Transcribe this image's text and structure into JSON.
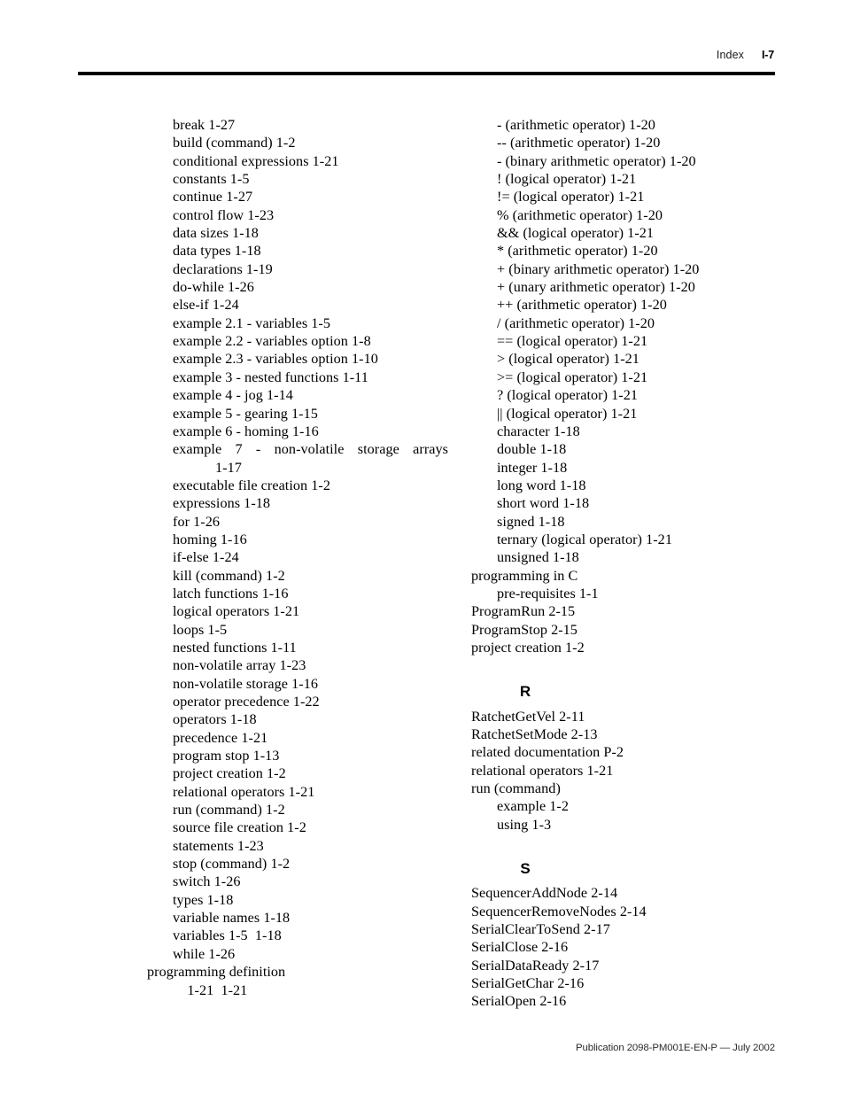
{
  "header": {
    "section_label": "Index",
    "folio": "I-7"
  },
  "footer": {
    "text": "Publication 2098-PM001E-EN-P — July 2002"
  },
  "columns": {
    "left": {
      "entries": [
        {
          "level": 2,
          "text": "break 1-27"
        },
        {
          "level": 2,
          "text": "build (command) 1-2"
        },
        {
          "level": 2,
          "text": "conditional expressions 1-21"
        },
        {
          "level": 2,
          "text": "constants 1-5"
        },
        {
          "level": 2,
          "text": "continue 1-27"
        },
        {
          "level": 2,
          "text": "control flow 1-23"
        },
        {
          "level": 2,
          "text": "data sizes 1-18"
        },
        {
          "level": 2,
          "text": "data types 1-18"
        },
        {
          "level": 2,
          "text": "declarations 1-19"
        },
        {
          "level": 2,
          "text": "do-while 1-26"
        },
        {
          "level": 2,
          "text": "else-if 1-24"
        },
        {
          "level": 2,
          "text": "example 2.1 - variables 1-5"
        },
        {
          "level": 2,
          "text": "example 2.2 - variables option 1-8"
        },
        {
          "level": 2,
          "text": "example 2.3 - variables option 1-10"
        },
        {
          "level": 2,
          "text": "example 3 - nested functions 1-11"
        },
        {
          "level": 2,
          "text": "example 4 - jog 1-14"
        },
        {
          "level": 2,
          "text": "example 5 - gearing 1-15"
        },
        {
          "level": 2,
          "text": "example 6 - homing 1-16"
        },
        {
          "level": 2,
          "wrap": true,
          "first": "example 7 - non-volatile storage arrays",
          "rest": "1-17"
        },
        {
          "level": 2,
          "text": "executable file creation 1-2"
        },
        {
          "level": 2,
          "text": "expressions 1-18"
        },
        {
          "level": 2,
          "text": "for 1-26"
        },
        {
          "level": 2,
          "text": "homing 1-16"
        },
        {
          "level": 2,
          "text": "if-else 1-24"
        },
        {
          "level": 2,
          "text": "kill (command) 1-2"
        },
        {
          "level": 2,
          "text": "latch functions 1-16"
        },
        {
          "level": 2,
          "text": "logical operators 1-21"
        },
        {
          "level": 2,
          "text": "loops 1-5"
        },
        {
          "level": 2,
          "text": "nested functions 1-11"
        },
        {
          "level": 2,
          "text": "non-volatile array 1-23"
        },
        {
          "level": 2,
          "text": "non-volatile storage 1-16"
        },
        {
          "level": 2,
          "text": "operator precedence 1-22"
        },
        {
          "level": 2,
          "text": "operators 1-18"
        },
        {
          "level": 2,
          "text": "precedence 1-21"
        },
        {
          "level": 2,
          "text": "program stop 1-13"
        },
        {
          "level": 2,
          "text": "project creation 1-2"
        },
        {
          "level": 2,
          "text": "relational operators 1-21"
        },
        {
          "level": 2,
          "text": "run (command) 1-2"
        },
        {
          "level": 2,
          "text": "source file creation 1-2"
        },
        {
          "level": 2,
          "text": "statements 1-23"
        },
        {
          "level": 2,
          "text": "stop (command) 1-2"
        },
        {
          "level": 2,
          "text": "switch 1-26"
        },
        {
          "level": 2,
          "text": "types 1-18"
        },
        {
          "level": 2,
          "text": "variable names 1-18"
        },
        {
          "level": 2,
          "text": "variables 1-5  1-18"
        },
        {
          "level": 2,
          "text": "while 1-26"
        },
        {
          "level": 1,
          "text": "programming definition"
        },
        {
          "level": 2,
          "text": "    1-21  1-21"
        }
      ]
    },
    "right": {
      "blocks": [
        {
          "type": "entries",
          "entries": [
            {
              "level": 2,
              "text": "- (arithmetic operator) 1-20"
            },
            {
              "level": 2,
              "text": "-- (arithmetic operator) 1-20"
            },
            {
              "level": 2,
              "text": "- (binary arithmetic operator) 1-20"
            },
            {
              "level": 2,
              "text": "! (logical operator) 1-21"
            },
            {
              "level": 2,
              "text": "!= (logical operator) 1-21"
            },
            {
              "level": 2,
              "text": "% (arithmetic operator) 1-20"
            },
            {
              "level": 2,
              "text": "&& (logical operator) 1-21"
            },
            {
              "level": 2,
              "text": "* (arithmetic operator) 1-20"
            },
            {
              "level": 2,
              "text": "+ (binary arithmetic operator) 1-20"
            },
            {
              "level": 2,
              "text": "+ (unary arithmetic operator) 1-20"
            },
            {
              "level": 2,
              "text": "++ (arithmetic operator) 1-20"
            },
            {
              "level": 2,
              "text": "/ (arithmetic operator) 1-20"
            },
            {
              "level": 2,
              "text": "== (logical operator) 1-21"
            },
            {
              "level": 2,
              "text": "> (logical operator) 1-21"
            },
            {
              "level": 2,
              "text": ">= (logical operator) 1-21"
            },
            {
              "level": 2,
              "text": "? (logical operator) 1-21"
            },
            {
              "level": 2,
              "text": "|| (logical operator) 1-21"
            },
            {
              "level": 2,
              "text": "character 1-18"
            },
            {
              "level": 2,
              "text": "double 1-18"
            },
            {
              "level": 2,
              "text": "integer 1-18"
            },
            {
              "level": 2,
              "text": "long word 1-18"
            },
            {
              "level": 2,
              "text": "short word 1-18"
            },
            {
              "level": 2,
              "text": "signed 1-18"
            },
            {
              "level": 2,
              "text": "ternary (logical operator) 1-21"
            },
            {
              "level": 2,
              "text": "unsigned 1-18"
            },
            {
              "level": 1,
              "text": "programming in C"
            },
            {
              "level": 2,
              "text": "pre-requisites 1-1"
            },
            {
              "level": 1,
              "text": "ProgramRun 2-15"
            },
            {
              "level": 1,
              "text": "ProgramStop 2-15"
            },
            {
              "level": 1,
              "text": "project creation 1-2"
            }
          ]
        },
        {
          "type": "section",
          "letter": "R",
          "entries": [
            {
              "level": 1,
              "text": "RatchetGetVel 2-11"
            },
            {
              "level": 1,
              "text": "RatchetSetMode 2-13"
            },
            {
              "level": 1,
              "text": "related documentation P-2"
            },
            {
              "level": 1,
              "text": "relational operators 1-21"
            },
            {
              "level": 1,
              "text": "run (command)"
            },
            {
              "level": 2,
              "text": "example 1-2"
            },
            {
              "level": 2,
              "text": "using 1-3"
            }
          ]
        },
        {
          "type": "section",
          "letter": "S",
          "entries": [
            {
              "level": 1,
              "text": "SequencerAddNode 2-14"
            },
            {
              "level": 1,
              "text": "SequencerRemoveNodes 2-14"
            },
            {
              "level": 1,
              "text": "SerialClearToSend 2-17"
            },
            {
              "level": 1,
              "text": "SerialClose 2-16"
            },
            {
              "level": 1,
              "text": "SerialDataReady 2-17"
            },
            {
              "level": 1,
              "text": "SerialGetChar 2-16"
            },
            {
              "level": 1,
              "text": "SerialOpen 2-16"
            }
          ]
        }
      ]
    }
  }
}
